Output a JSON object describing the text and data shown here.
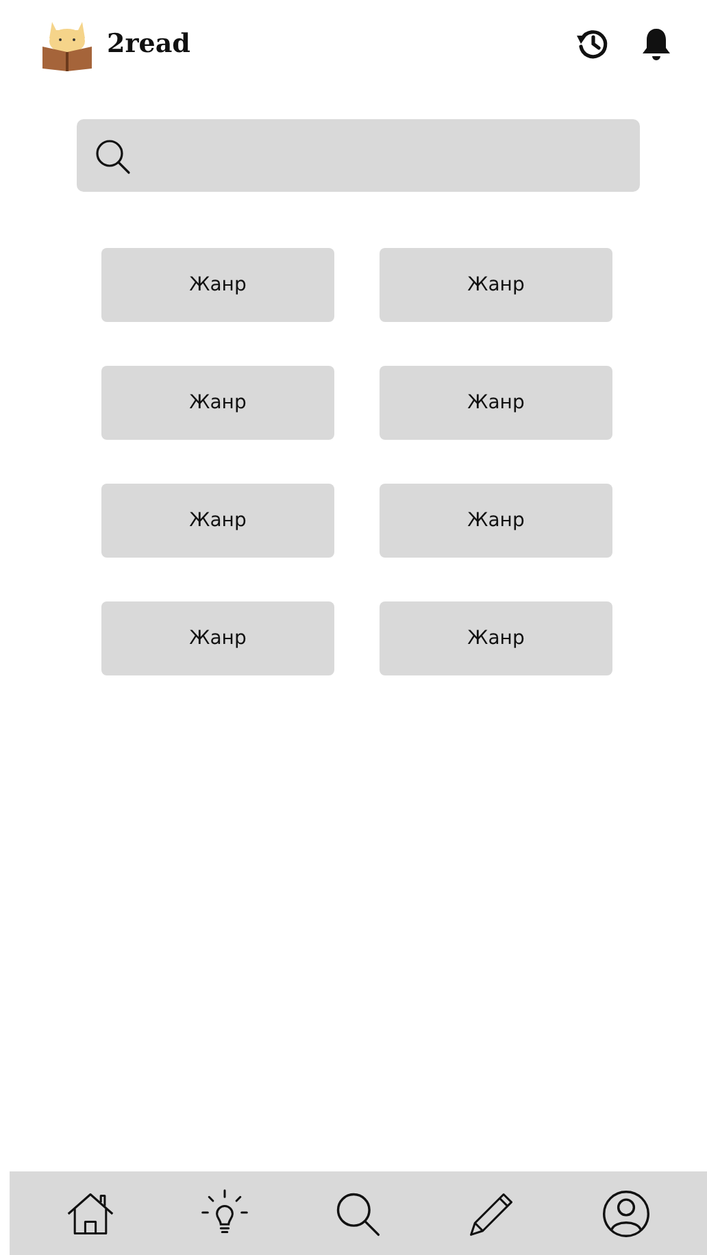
{
  "header": {
    "title": "2read"
  },
  "genres": [
    {
      "label": "Жанр"
    },
    {
      "label": "Жанр"
    },
    {
      "label": "Жанр"
    },
    {
      "label": "Жанр"
    },
    {
      "label": "Жанр"
    },
    {
      "label": "Жанр"
    },
    {
      "label": "Жанр"
    },
    {
      "label": "Жанр"
    }
  ],
  "nav": [
    {
      "kind": "home"
    },
    {
      "kind": "ideas"
    },
    {
      "kind": "search"
    },
    {
      "kind": "write"
    },
    {
      "kind": "profile"
    }
  ]
}
